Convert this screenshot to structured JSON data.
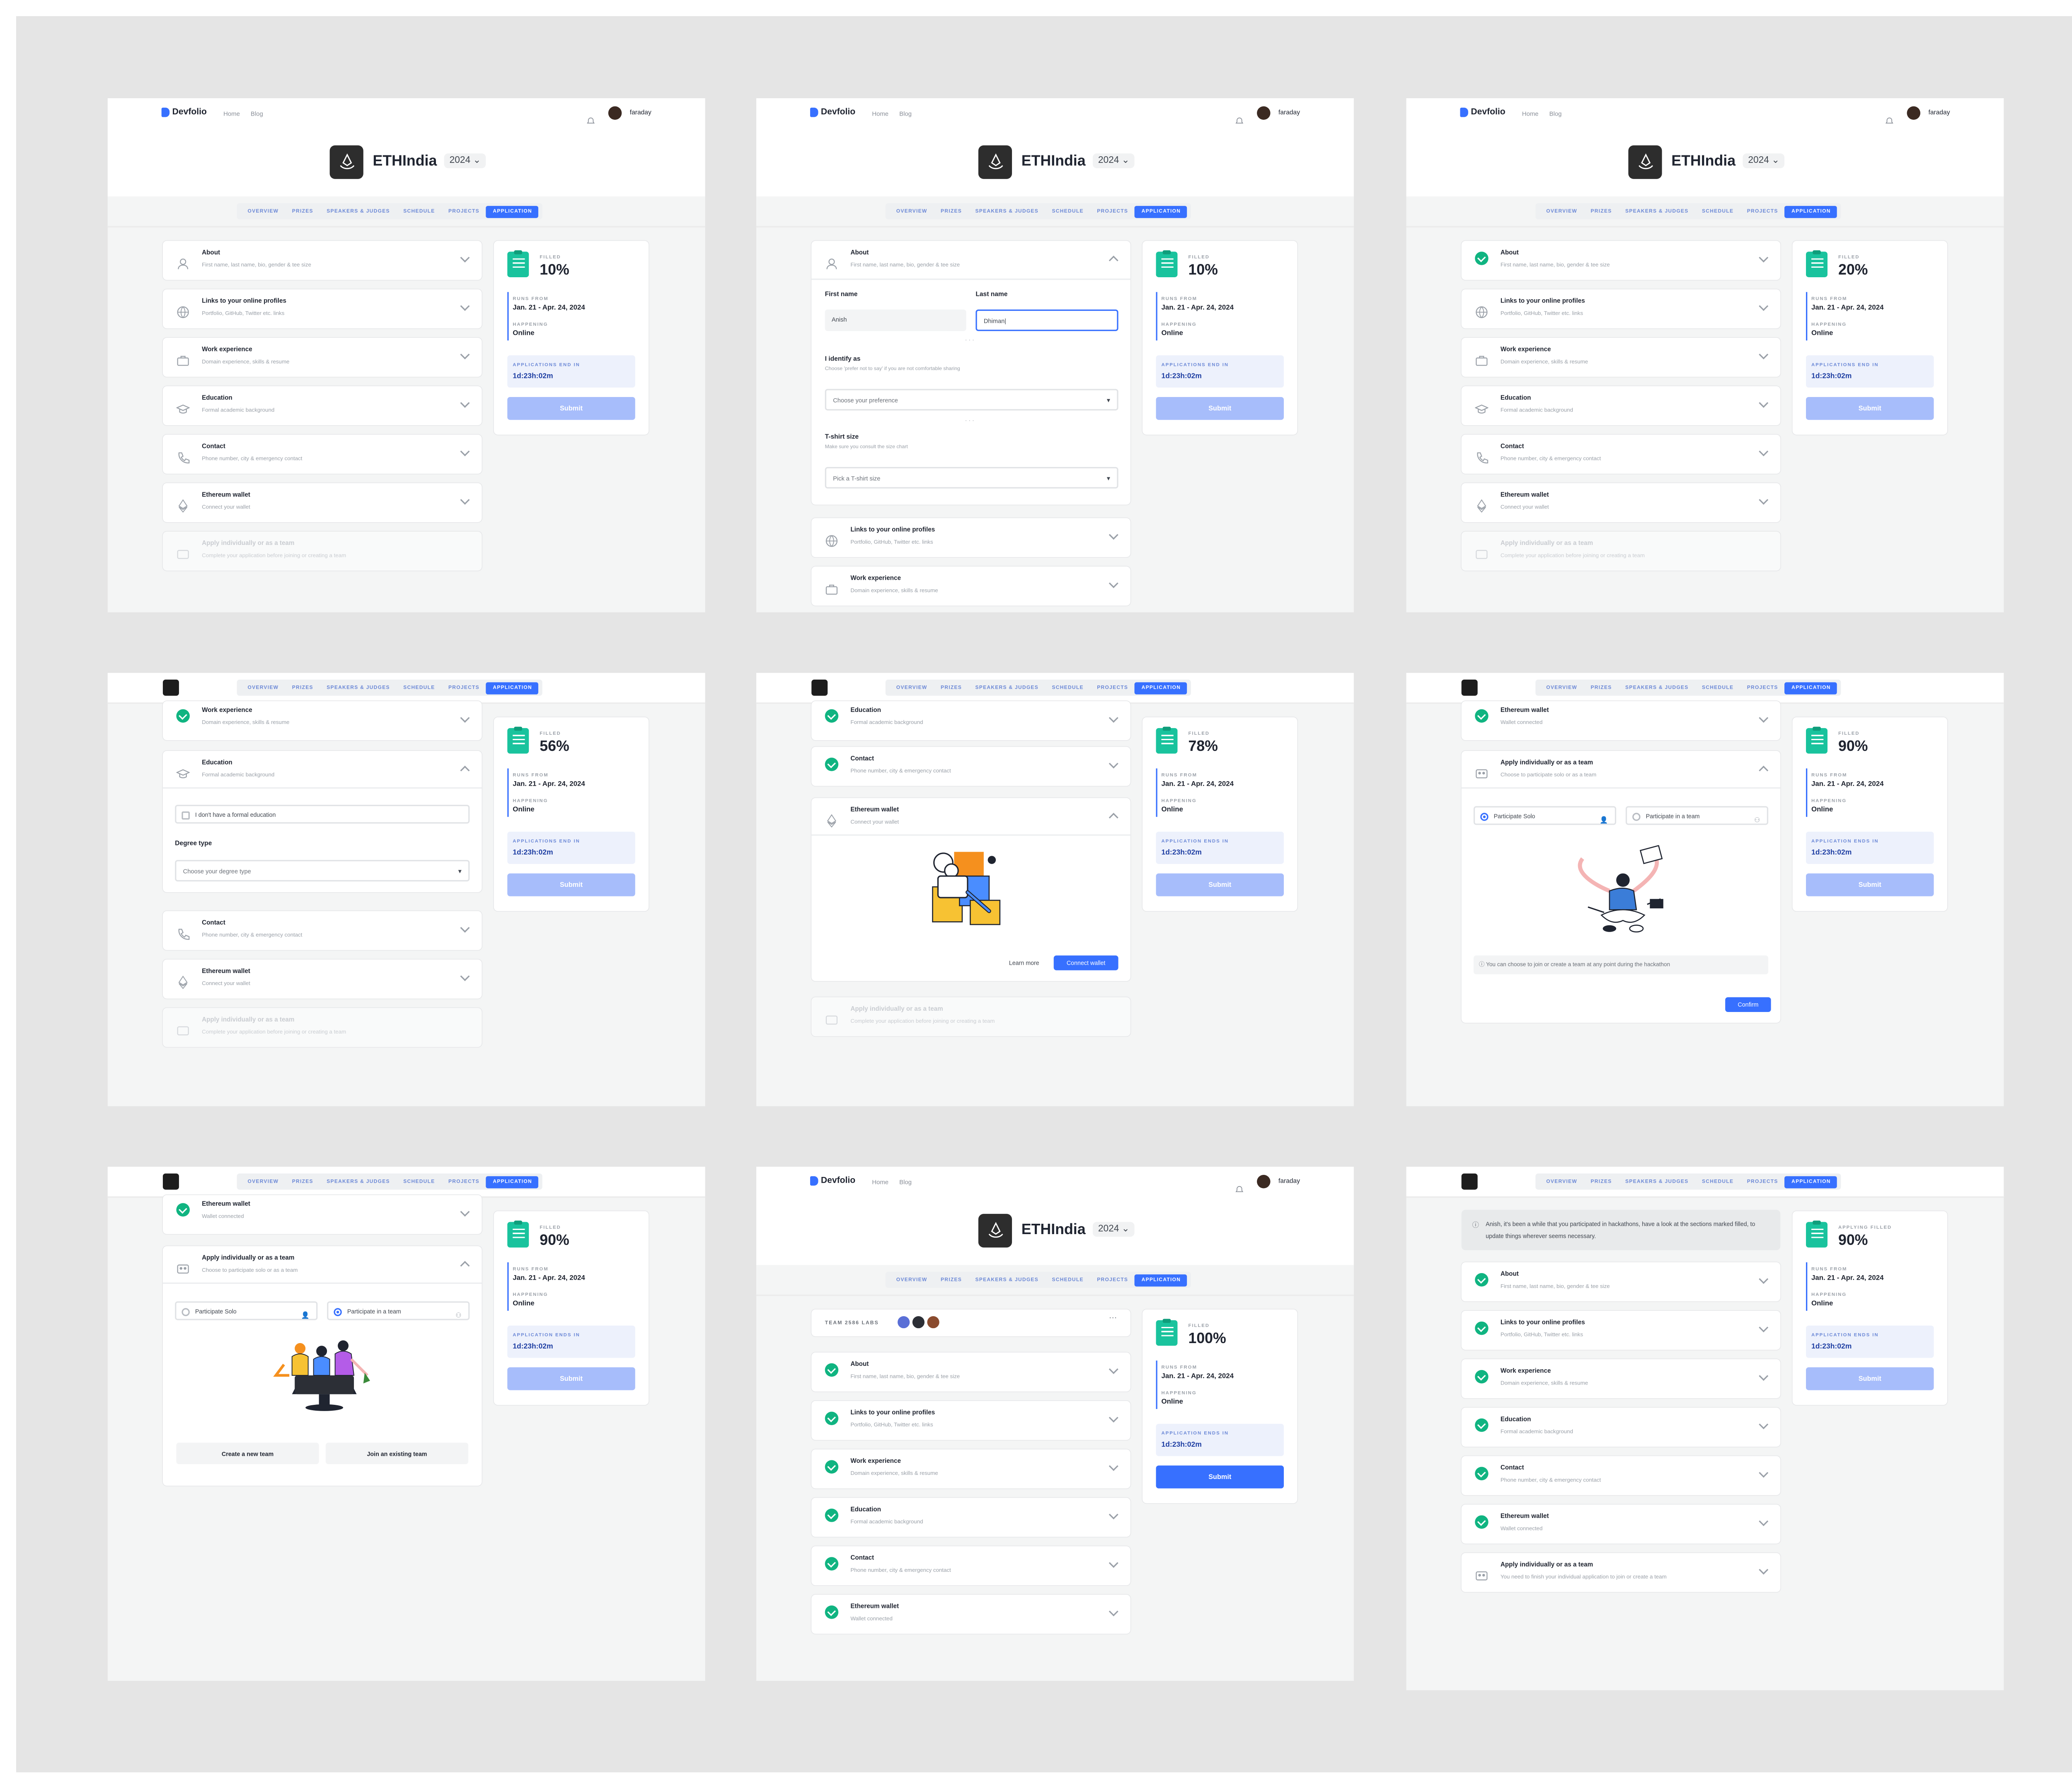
{
  "nav": {
    "brand": "Devfolio",
    "links": [
      "Home",
      "Blog"
    ],
    "user": "faraday"
  },
  "event": {
    "name": "ETHIndia",
    "year": "2024"
  },
  "tabs": [
    "OVERVIEW",
    "PRIZES",
    "SPEAKERS & JUDGES",
    "SCHEDULE",
    "PROJECTS",
    "APPLICATION"
  ],
  "sections": {
    "about": {
      "title": "About",
      "subtitle": "First name, last name, bio, gender & tee size"
    },
    "links": {
      "title": "Links to your online profiles",
      "subtitle": "Portfolio, GitHub, Twitter etc. links"
    },
    "work": {
      "title": "Work experience",
      "subtitle": "Domain experience, skills & resume"
    },
    "education": {
      "title": "Education",
      "subtitle": "Formal academic background"
    },
    "contact": {
      "title": "Contact",
      "subtitle": "Phone number, city & emergency contact"
    },
    "wallet": {
      "title": "Ethereum wallet",
      "subtitle": "Connect your wallet",
      "subtitle_connected": "Wallet connected"
    },
    "team": {
      "title": "Apply individually or as a team",
      "subtitle": "Complete your application before joining or creating a team",
      "subtitle_choose": "Choose to participate solo or as a team",
      "subtitle_finish": "You need to finish your individual application to join or create a team"
    }
  },
  "status": {
    "filled_label": "FILLED",
    "applying_filled_label": "APPLYING FILLED",
    "runs_label": "RUNS FROM",
    "runs_value": "Jan. 21 - Apr. 24, 2024",
    "happening_label": "HAPPENING",
    "happening_value": "Online",
    "end_label_a": "APPLICATIONS END IN",
    "end_label_b": "APPLICATION ENDS IN",
    "end_value": "1d:23h:02m",
    "submit": "Submit"
  },
  "panels": {
    "p1": {
      "percent": "10%"
    },
    "p2": {
      "percent": "10%"
    },
    "p3": {
      "percent": "20%"
    },
    "p4": {
      "percent": "56%"
    },
    "p5": {
      "percent": "78%"
    },
    "p6": {
      "percent": "90%"
    },
    "p7": {
      "percent": "90%"
    },
    "p8": {
      "percent": "100%"
    },
    "p9": {
      "percent": "90%"
    }
  },
  "about_form": {
    "first_name_label": "First name",
    "first_name_value": "Anish",
    "last_name_label": "Last name",
    "last_name_value": "Dhiman|",
    "identify_label": "I identify as",
    "identify_hint": "Choose 'prefer not to say' if you are not comfortable sharing",
    "identify_placeholder": "Choose your preference",
    "tshirt_label": "T-shirt size",
    "tshirt_hint": "Make sure you consult the size chart",
    "tshirt_placeholder": "Pick a T-shirt size"
  },
  "education_form": {
    "no_formal": "I don't have a formal education",
    "degree_label": "Degree type",
    "degree_placeholder": "Choose your degree type"
  },
  "wallet_form": {
    "learn_more": "Learn more",
    "connect": "Connect wallet"
  },
  "team_form": {
    "solo": "Participate Solo",
    "team": "Participate in a team",
    "info": "You can choose to join or create a team at any point during the hackathon",
    "confirm": "Confirm",
    "create": "Create a new team",
    "join": "Join an existing team"
  },
  "team_bar": {
    "name": "TEAM 2586 LABS"
  },
  "notice": {
    "text": "Anish, it's been a while that you participated in hackathons, have a look at the sections marked filled, to update things wherever seems necessary."
  },
  "colors": {
    "accent": "#3770ff",
    "success": "#10b481",
    "brand_teal": "#19c39d"
  }
}
